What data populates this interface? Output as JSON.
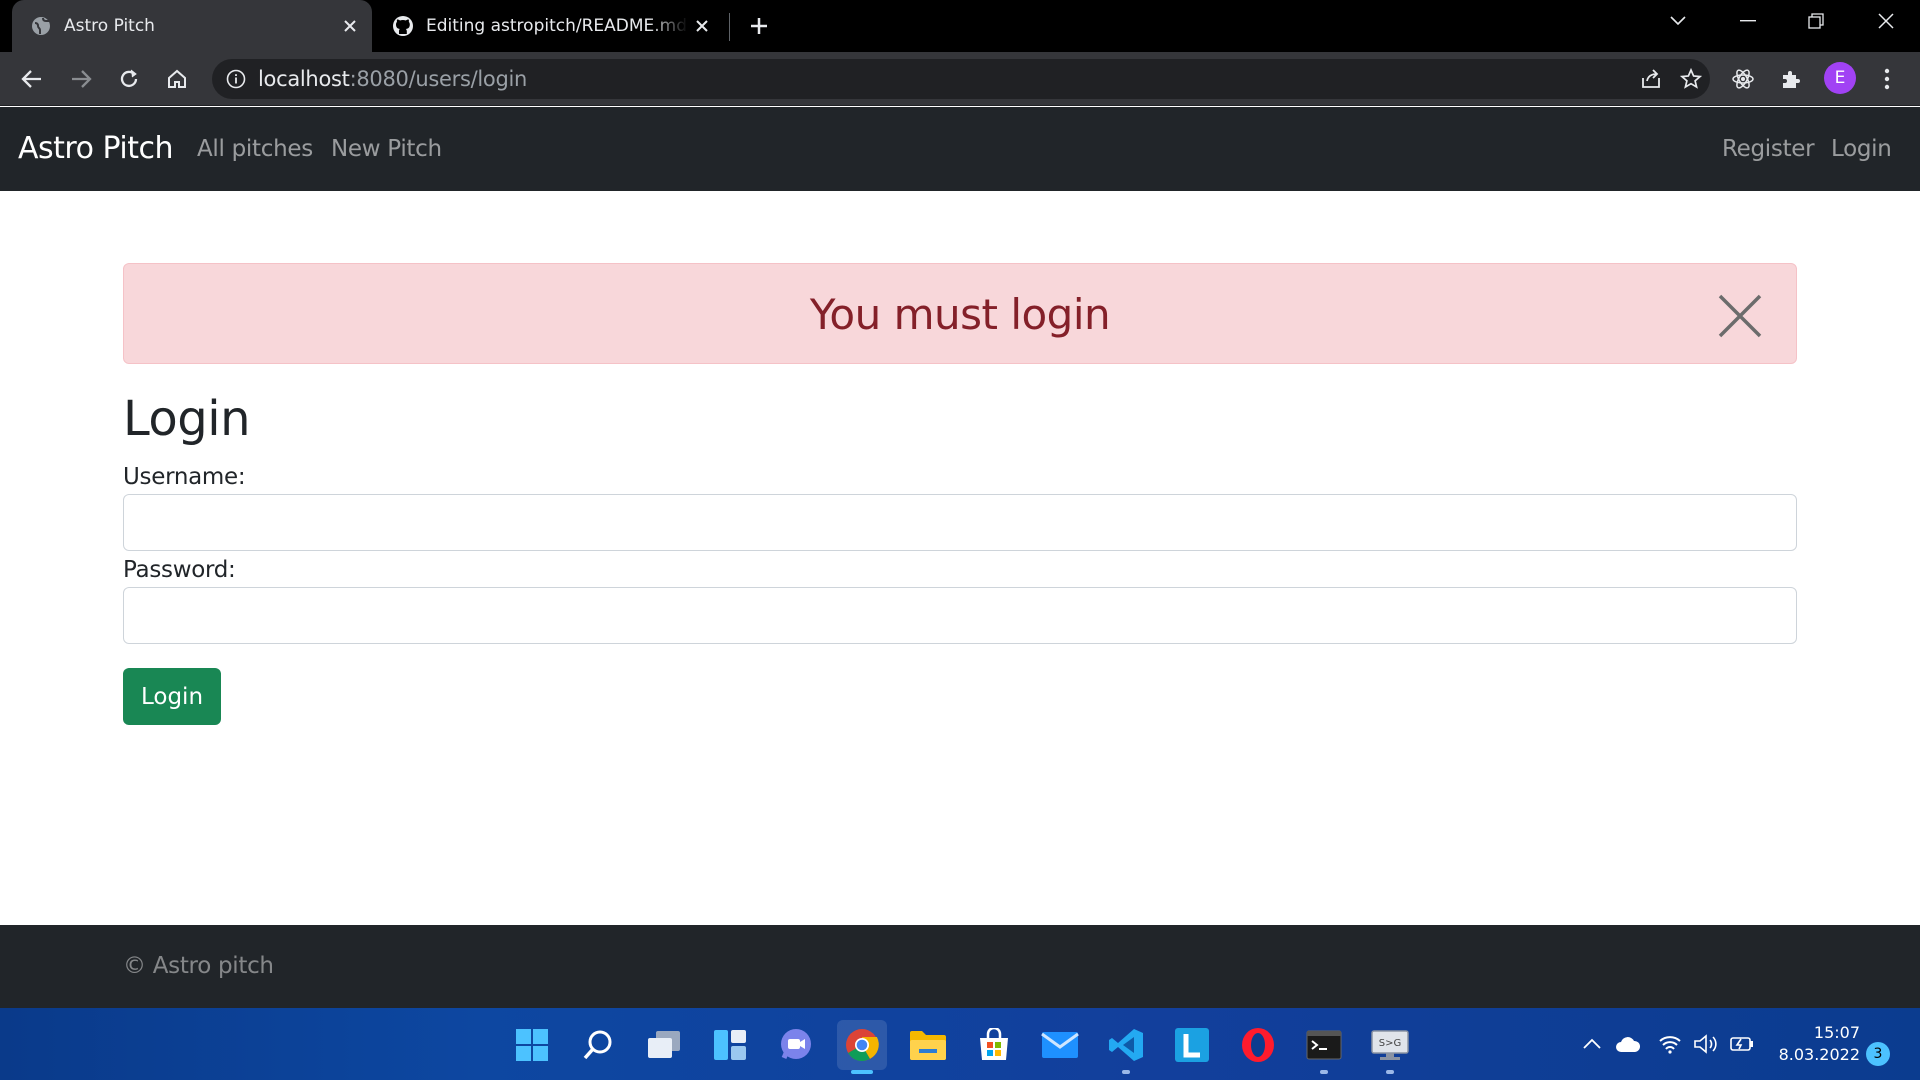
{
  "browser": {
    "tabs": [
      {
        "title": "Astro Pitch",
        "icon": "globe-icon",
        "active": true
      },
      {
        "title": "Editing astropitch/README.md at main",
        "icon": "github-icon",
        "active": false
      }
    ],
    "url": {
      "host": "localhost",
      "path": ":8080/users/login"
    },
    "profile_initial": "E"
  },
  "page": {
    "brand": "Astro Pitch",
    "nav_left": [
      "All pitches",
      "New Pitch"
    ],
    "nav_right": [
      "Register",
      "Login"
    ],
    "alert": {
      "message": "You must login",
      "color": "#842029",
      "background": "#f8d7da"
    },
    "form": {
      "heading": "Login",
      "username_label": "Username:",
      "username_value": "",
      "password_label": "Password:",
      "password_value": "",
      "submit_label": "Login",
      "submit_color": "#198754"
    },
    "footer": "© Astro pitch"
  },
  "taskbar": {
    "apps": [
      "start-icon",
      "search-icon",
      "task-view-icon",
      "widgets-icon",
      "teams-chat-icon",
      "chrome-icon",
      "file-explorer-icon",
      "microsoft-store-icon",
      "mail-icon",
      "vscode-icon",
      "l-app-icon",
      "opera-icon",
      "terminal-icon",
      "remote-desktop-icon"
    ],
    "active_app": "chrome-icon",
    "time": "15:07",
    "date": "8.03.2022",
    "notifications": "3"
  }
}
